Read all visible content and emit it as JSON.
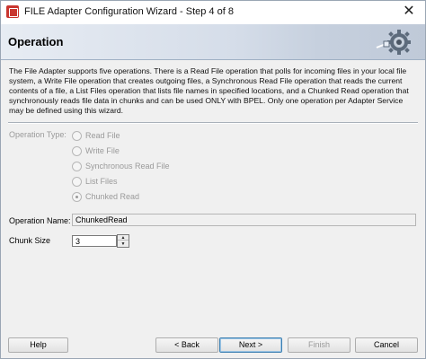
{
  "window": {
    "title": "FILE Adapter Configuration Wizard - Step 4 of 8",
    "close_glyph": "✕"
  },
  "banner": {
    "title": "Operation",
    "icon": "gear-plug-icon"
  },
  "description": "The File Adapter supports five operations.  There is a Read File operation that polls for incoming files in your local file system, a Write File operation that creates outgoing files, a Synchronous Read File operation that reads the current contents of a file, a List Files operation that lists file names in specified locations, and a Chunked Read operation that synchronously reads file data in chunks and can be used ONLY with BPEL. Only one operation per Adapter Service may be defined using this wizard.",
  "operation_type": {
    "label": "Operation Type:",
    "options": [
      {
        "label": "Read File",
        "selected": false
      },
      {
        "label": "Write File",
        "selected": false
      },
      {
        "label": "Synchronous Read File",
        "selected": false
      },
      {
        "label": "List Files",
        "selected": false
      },
      {
        "label": "Chunked Read",
        "selected": true
      }
    ],
    "enabled": false
  },
  "operation_name": {
    "label": "Operation Name:",
    "value": "ChunkedRead"
  },
  "chunk_size": {
    "label": "Chunk Size",
    "value": "3"
  },
  "buttons": {
    "help": "Help",
    "back": "< Back",
    "next": "Next >",
    "finish": "Finish",
    "cancel": "Cancel"
  },
  "colors": {
    "banner_start": "#e7ecf3",
    "banner_end": "#bfc9d8",
    "disabled_text": "#9a9a9a",
    "primary_border": "#3c7fb1"
  }
}
